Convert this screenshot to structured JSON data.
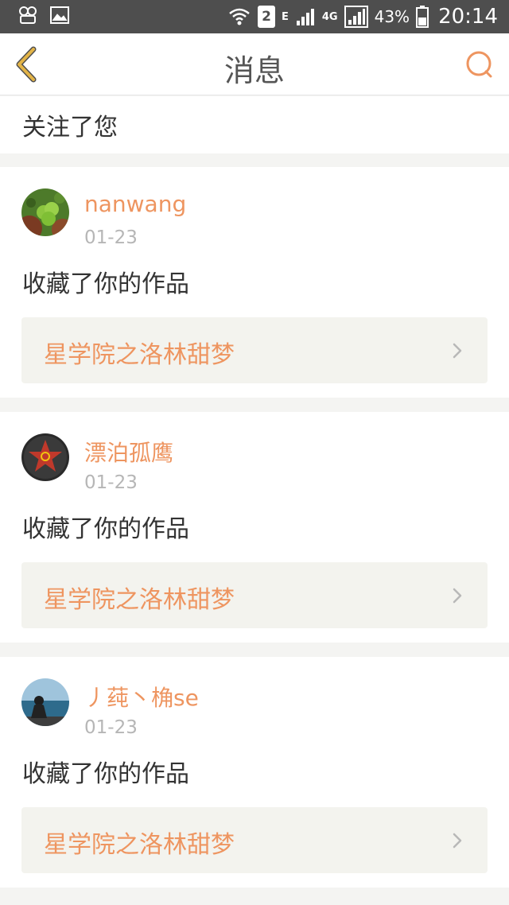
{
  "status_bar": {
    "signal_label": "E",
    "network": "4G",
    "sim_slot": "2",
    "battery": "43%",
    "time": "20:14"
  },
  "nav": {
    "title": "消息",
    "back_icon": "chevron-left-icon",
    "search_icon": "search-icon"
  },
  "partial_item": {
    "action": "关注了您"
  },
  "messages": [
    {
      "username": "nanwang",
      "date": "01-23",
      "action": "收藏了你的作品",
      "work_title": "星学院之洛林甜梦"
    },
    {
      "username": "漂泊孤鹰",
      "date": "01-23",
      "action": "收藏了你的作品",
      "work_title": "星学院之洛林甜梦"
    },
    {
      "username": "丿莼丶桷se",
      "date": "01-23",
      "action": "收藏了你的作品",
      "work_title": "星学院之洛林甜梦"
    }
  ],
  "colors": {
    "accent": "#ee9560",
    "back_icon": "#e3b447",
    "status_bar": "#4e4e4e"
  }
}
